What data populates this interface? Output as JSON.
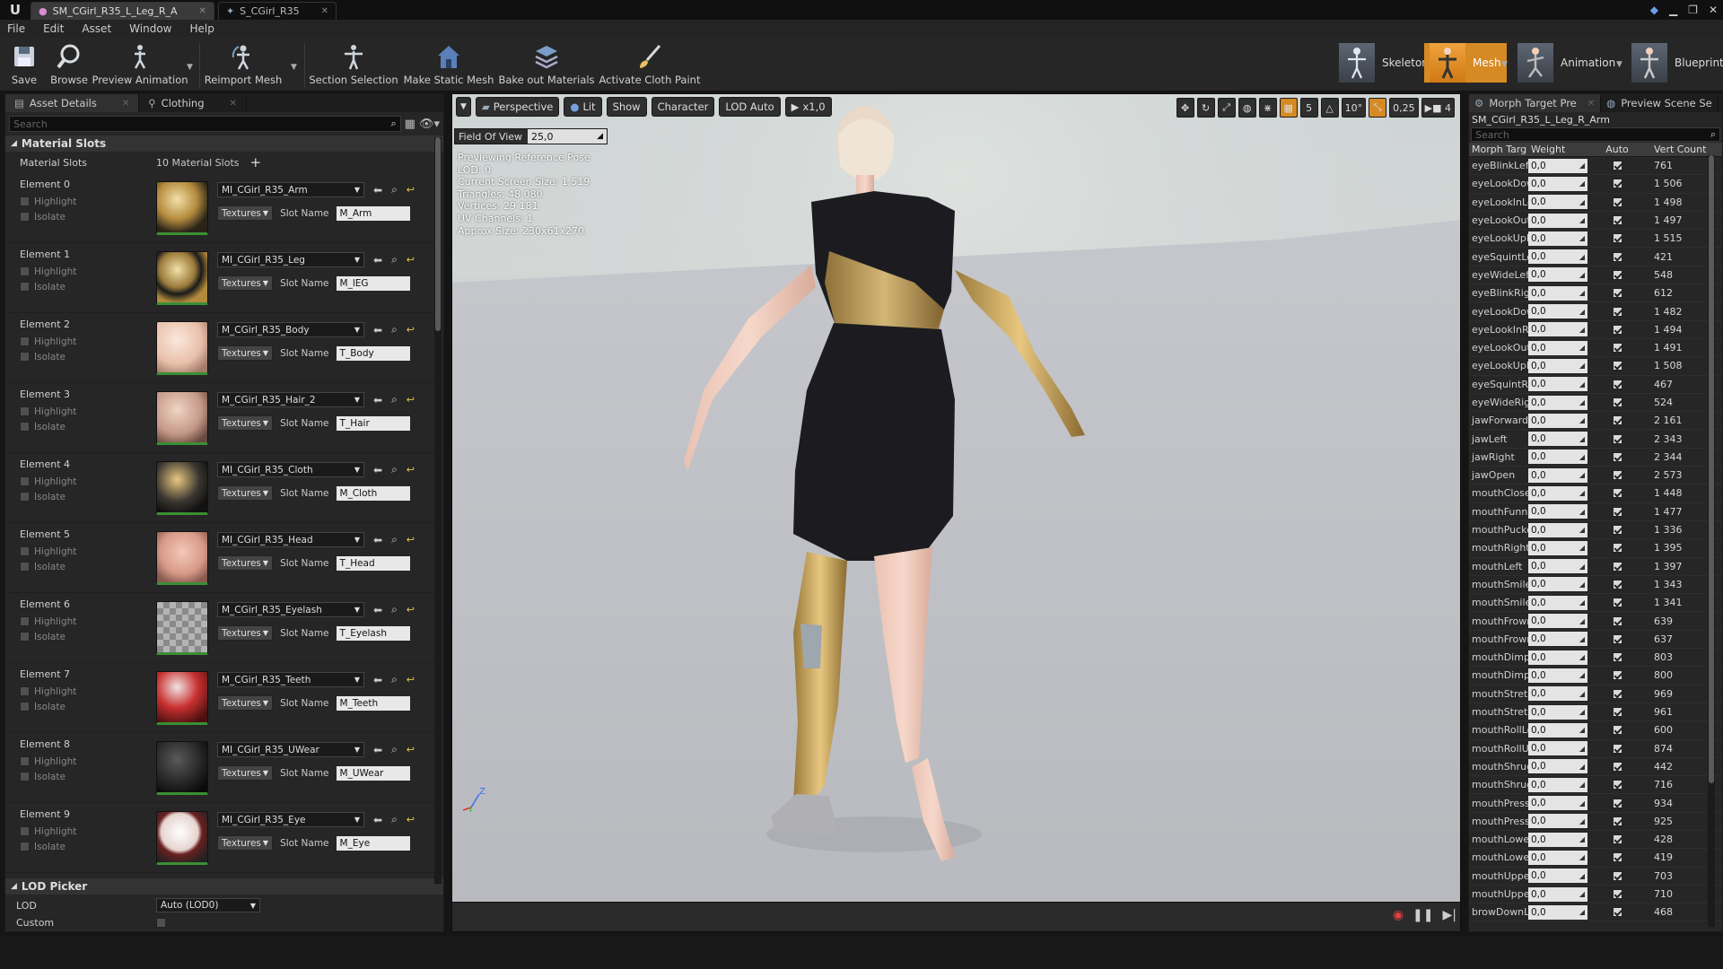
{
  "tabs": [
    {
      "label": "SM_CGirl_R35_L_Leg_R_A"
    },
    {
      "label": "S_CGirl_R35"
    }
  ],
  "menu": [
    "File",
    "Edit",
    "Asset",
    "Window",
    "Help"
  ],
  "toolbar": {
    "save": "Save",
    "browse": "Browse",
    "preview_animation": "Preview Animation",
    "reimport_mesh": "Reimport Mesh",
    "section_selection": "Section Selection",
    "make_static_mesh": "Make Static Mesh",
    "bake_out_materials": "Bake out Materials",
    "activate_cloth_paint": "Activate Cloth Paint"
  },
  "modes": {
    "skeleton": "Skeleton",
    "mesh": "Mesh",
    "animation": "Animation",
    "blueprint": "Blueprint"
  },
  "left_panel": {
    "tabs": [
      "Asset Details",
      "Clothing"
    ],
    "search_placeholder": "Search",
    "category": "Material Slots",
    "prop_label": "Material Slots",
    "prop_value": "10 Material Slots",
    "highlight": "Highlight",
    "isolate": "Isolate",
    "textures": "Textures",
    "slot_name_label": "Slot Name",
    "elements": [
      {
        "label": "Element 0",
        "material": "MI_CGirl_R35_Arm",
        "slot": "M_Arm",
        "swatch": "gold"
      },
      {
        "label": "Element 1",
        "material": "MI_CGirl_R35_Leg",
        "slot": "M_lEG",
        "swatch": "goldstripe"
      },
      {
        "label": "Element 2",
        "material": "M_CGirl_R35_Body",
        "slot": "T_Body",
        "swatch": "skin"
      },
      {
        "label": "Element 3",
        "material": "M_CGirl_R35_Hair_2",
        "slot": "T_Hair",
        "swatch": "hair"
      },
      {
        "label": "Element 4",
        "material": "MI_CGirl_R35_Cloth",
        "slot": "M_Cloth",
        "swatch": "cloth"
      },
      {
        "label": "Element 5",
        "material": "MI_CGirl_R35_Head",
        "slot": "T_Head",
        "swatch": "head"
      },
      {
        "label": "Element 6",
        "material": "M_CGirl_R35_Eyelash",
        "slot": "T_Eyelash",
        "swatch": "checker"
      },
      {
        "label": "Element 7",
        "material": "M_CGirl_R35_Teeth",
        "slot": "M_Teeth",
        "swatch": "red"
      },
      {
        "label": "Element 8",
        "material": "MI_CGirl_R35_UWear",
        "slot": "M_UWear",
        "swatch": "black"
      },
      {
        "label": "Element 9",
        "material": "MI_CGirl_R35_Eye",
        "slot": "M_Eye",
        "swatch": "eye"
      }
    ],
    "lod_category": "LOD Picker",
    "lod_label": "LOD",
    "lod_value": "Auto (LOD0)",
    "custom_label": "Custom"
  },
  "viewport": {
    "buttons": {
      "perspective": "Perspective",
      "lit": "Lit",
      "show": "Show",
      "character": "Character",
      "lod_auto": "LOD Auto",
      "speed": "x1,0"
    },
    "snap_grid": "5",
    "snap_angle": "10°",
    "snap_scale": "0,25",
    "camera_speed": "4",
    "fov_label": "Field Of View",
    "fov_value": "25,0",
    "stats": [
      "Previewing Reference Pose",
      "LOD: 0",
      "Current Screen Size: 1,519",
      "Triangles: 48 080",
      "Vertices: 29 181",
      "UV Channels: 1",
      "Approx Size: 230x61x270"
    ]
  },
  "right_panel": {
    "tabs": [
      "Morph Target Pre",
      "Preview Scene Se"
    ],
    "asset_name": "SM_CGirl_R35_L_Leg_R_Arm",
    "search_placeholder": "Search",
    "columns": [
      "Morph Targ",
      "Weight",
      "Auto",
      "Vert Count"
    ],
    "rows": [
      {
        "name": "eyeBlinkLeft",
        "weight": "0,0",
        "verts": "761"
      },
      {
        "name": "eyeLookDownLeft",
        "weight": "0,0",
        "verts": "1 506"
      },
      {
        "name": "eyeLookInLeft",
        "weight": "0,0",
        "verts": "1 498"
      },
      {
        "name": "eyeLookOutLeft",
        "weight": "0,0",
        "verts": "1 497"
      },
      {
        "name": "eyeLookUpLeft",
        "weight": "0,0",
        "verts": "1 515"
      },
      {
        "name": "eyeSquintLeft",
        "weight": "0,0",
        "verts": "421"
      },
      {
        "name": "eyeWideLeft",
        "weight": "0,0",
        "verts": "548"
      },
      {
        "name": "eyeBlinkRight",
        "weight": "0,0",
        "verts": "612"
      },
      {
        "name": "eyeLookDownRight",
        "weight": "0,0",
        "verts": "1 482"
      },
      {
        "name": "eyeLookInRight",
        "weight": "0,0",
        "verts": "1 494"
      },
      {
        "name": "eyeLookOutRight",
        "weight": "0,0",
        "verts": "1 491"
      },
      {
        "name": "eyeLookUpRight",
        "weight": "0,0",
        "verts": "1 508"
      },
      {
        "name": "eyeSquintRight",
        "weight": "0,0",
        "verts": "467"
      },
      {
        "name": "eyeWideRight",
        "weight": "0,0",
        "verts": "524"
      },
      {
        "name": "jawForward",
        "weight": "0,0",
        "verts": "2 161"
      },
      {
        "name": "jawLeft",
        "weight": "0,0",
        "verts": "2 343"
      },
      {
        "name": "jawRight",
        "weight": "0,0",
        "verts": "2 344"
      },
      {
        "name": "jawOpen",
        "weight": "0,0",
        "verts": "2 573"
      },
      {
        "name": "mouthClose",
        "weight": "0,0",
        "verts": "1 448"
      },
      {
        "name": "mouthFunnel",
        "weight": "0,0",
        "verts": "1 477"
      },
      {
        "name": "mouthPucker",
        "weight": "0,0",
        "verts": "1 336"
      },
      {
        "name": "mouthRight",
        "weight": "0,0",
        "verts": "1 395"
      },
      {
        "name": "mouthLeft",
        "weight": "0,0",
        "verts": "1 397"
      },
      {
        "name": "mouthSmileLeft",
        "weight": "0,0",
        "verts": "1 343"
      },
      {
        "name": "mouthSmileRight",
        "weight": "0,0",
        "verts": "1 341"
      },
      {
        "name": "mouthFrownLeft",
        "weight": "0,0",
        "verts": "639"
      },
      {
        "name": "mouthFrownRight",
        "weight": "0,0",
        "verts": "637"
      },
      {
        "name": "mouthDimpleLeft",
        "weight": "0,0",
        "verts": "803"
      },
      {
        "name": "mouthDimpleRight",
        "weight": "0,0",
        "verts": "800"
      },
      {
        "name": "mouthStretchLeft",
        "weight": "0,0",
        "verts": "969"
      },
      {
        "name": "mouthStretchRight",
        "weight": "0,0",
        "verts": "961"
      },
      {
        "name": "mouthRollLower",
        "weight": "0,0",
        "verts": "600"
      },
      {
        "name": "mouthRollUpper",
        "weight": "0,0",
        "verts": "874"
      },
      {
        "name": "mouthShrugLower",
        "weight": "0,0",
        "verts": "442"
      },
      {
        "name": "mouthShrugUpper",
        "weight": "0,0",
        "verts": "716"
      },
      {
        "name": "mouthPressLeft",
        "weight": "0,0",
        "verts": "934"
      },
      {
        "name": "mouthPressRight",
        "weight": "0,0",
        "verts": "925"
      },
      {
        "name": "mouthLowerDownLeft",
        "weight": "0,0",
        "verts": "428"
      },
      {
        "name": "mouthLowerDownRight",
        "weight": "0,0",
        "verts": "419"
      },
      {
        "name": "mouthUpperUpLeft",
        "weight": "0,0",
        "verts": "703"
      },
      {
        "name": "mouthUpperUpRight",
        "weight": "0,0",
        "verts": "710"
      },
      {
        "name": "browDownLeft",
        "weight": "0,0",
        "verts": "468"
      }
    ]
  },
  "colors": {
    "accent": "#d68a24",
    "panel": "#262626",
    "slot_green": "#3a8f35"
  }
}
